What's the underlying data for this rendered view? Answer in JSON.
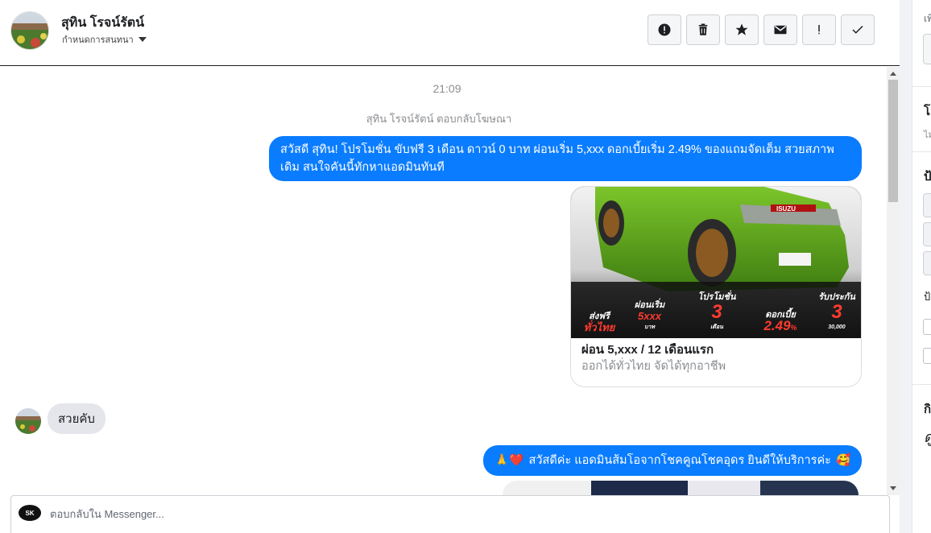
{
  "header": {
    "contact_name": "สุทิน โรจน์รัตน์",
    "assign_label": "กำหนดการสนทนา",
    "actions": [
      {
        "name": "mark-spam-button",
        "icon": "alert-circle-icon"
      },
      {
        "name": "delete-button",
        "icon": "trash-icon"
      },
      {
        "name": "star-button",
        "icon": "star-icon"
      },
      {
        "name": "mark-unread-button",
        "icon": "envelope-icon"
      },
      {
        "name": "follow-up-button",
        "icon": "exclamation-icon"
      },
      {
        "name": "mark-done-button",
        "icon": "checkmark-icon"
      }
    ]
  },
  "chat": {
    "timestamp": "21:09",
    "system_line": "สุทิน โรจน์รัตน์ ตอบกลับโฆษณา",
    "outgoing_message_1": "สวัสดี สุทิน! โปรโมชั่น ขับฟรี 3 เดือน ดาวน์ 0 บาท ผ่อนเริ่ม 5,xxx  ดอกเบี้ยเริ่ม 2.49% ของแถมจัดเต็ม สวยสภาพเดิม สนใจคันนี้ทักหาแอดมินทันที",
    "card": {
      "title": "ผ่อน 5,xxx / 12 เดือนแรก",
      "subtitle": "ออกได้ทั่วไทย จัดได้ทุกอาชีพ",
      "brand": "ISUZU",
      "promos": [
        {
          "top": "ส่งฟรี",
          "big": "ทั่วไทย",
          "small": ""
        },
        {
          "top": "ผ่อนเริ่ม",
          "big": "5xxx",
          "small": "บาท"
        },
        {
          "top": "โปรโมชั่น",
          "big": "3",
          "small": "เดือน"
        },
        {
          "top": "ดอกเบี้ย",
          "big": "2.49",
          "small": "%"
        },
        {
          "top": "รับประกัน",
          "big": "3",
          "small": "30,000"
        }
      ]
    },
    "incoming_message": "สวยคับ",
    "outgoing_message_2": "สวัสดีค่ะ แอดมินส้มโอจากโชคคูณโชคอุดร ยินดีให้บริการค่ะ",
    "outgoing_message_2_emoji_left": "🙏❤️",
    "outgoing_message_2_emoji_right": "🥰"
  },
  "reply": {
    "placeholder": "ตอบกลับใน Messenger...",
    "page_logo_text": "SK"
  },
  "right_panel": {
    "label_1": "เพิ่",
    "label_2": "โ",
    "label_2_sub": "ไม",
    "label_3": "ป้",
    "label_4": "ป้า",
    "label_5": "กิ",
    "label_6": "ดู"
  },
  "colors": {
    "accent_blue": "#0a7cff",
    "incoming_bubble": "#e4e6eb",
    "car_green": "#5aa51d",
    "promo_red": "#ff3b2f"
  }
}
